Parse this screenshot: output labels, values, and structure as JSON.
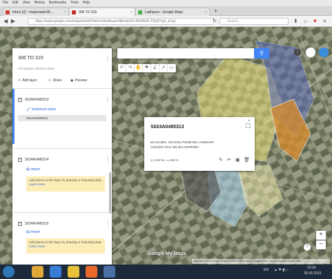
{
  "browser": {
    "menu": [
      "File",
      "Edit",
      "View",
      "History",
      "Bookmarks",
      "Tools",
      "Help"
    ],
    "tabs": [
      {
        "label": "Inbox (2) - mapmaster36...",
        "fav": "#d23f31",
        "active": false
      },
      {
        "label": "306 TO 315",
        "fav": "#c9302c",
        "active": true
      },
      {
        "label": "Lakhpura - Google Maps",
        "fav": "#4caf50",
        "active": false
      }
    ],
    "url": "https://www.google.com/maps/d/edit?mid=zy8udhuuer/8jtmxb/Dh-RNJ8GK-P9QDYgX_b7gs",
    "search_placeholder": "Search"
  },
  "panel": {
    "title": "306 TO 315",
    "subtitle": "All changes saved in Drive",
    "actions": {
      "add_layer": "Add layer",
      "share": "Share",
      "preview": "Preview"
    },
    "layers": [
      {
        "name": "S024A0480313",
        "link": "Individual styles",
        "item": "S024A0480313"
      },
      {
        "name": "S024A0480314",
        "link": "Import",
        "hint": "Add places to this layer by drawing or importing data.",
        "hint_link": "Learn more"
      },
      {
        "name": "S024A0480315",
        "link": "Import",
        "hint": "Add places to this layer by drawing or importing data.",
        "hint_link": "Learn more"
      }
    ]
  },
  "popup": {
    "title": "S024A0480313",
    "description": "M.A.M SEC. SCHOOL PGSM NO.1 NISHANT COLONY GALI NO.28 LAKHPURA",
    "area": "3.60 ha",
    "perimeter": "948 m"
  },
  "map": {
    "logo": "Google My Maps",
    "attribution": "Map data ©2016 Google Imagery ©2016 CNES / Airbus, DigitalGlobe, Landsat Imagery Digital Globe",
    "zoom_in": "+",
    "zoom_out": "−"
  },
  "taskbar": {
    "lang": "EN",
    "time": "23:06",
    "date": "26-06-2016"
  }
}
